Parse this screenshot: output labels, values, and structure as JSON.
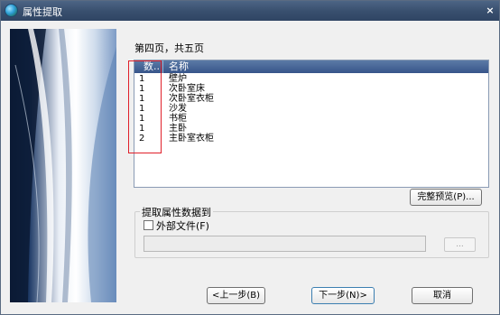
{
  "window": {
    "title": "属性提取",
    "close_glyph": "×"
  },
  "page_indicator": "第四页，共五页",
  "list": {
    "columns": [
      "数..",
      "名称"
    ],
    "rows": [
      {
        "qty": "1",
        "name": "壁炉"
      },
      {
        "qty": "1",
        "name": "次卧室床"
      },
      {
        "qty": "1",
        "name": "次卧室衣柜"
      },
      {
        "qty": "1",
        "name": "沙发"
      },
      {
        "qty": "1",
        "name": "书柜"
      },
      {
        "qty": "1",
        "name": "主卧"
      },
      {
        "qty": "2",
        "name": "主卧室衣柜"
      }
    ]
  },
  "preview_button": "完整预览(P)...",
  "extract_group": {
    "label": "提取属性数据到",
    "external_file_label": "外部文件(F)",
    "external_file_checked": false,
    "path_value": "",
    "browse_label": "..."
  },
  "footer": {
    "back_label": "<上一步(B)",
    "next_label": "下一步(N)>",
    "cancel_label": "取消"
  },
  "colors": {
    "titlebar": "#39506f",
    "list_header": "#37558a",
    "highlight_box": "#e0202a"
  }
}
